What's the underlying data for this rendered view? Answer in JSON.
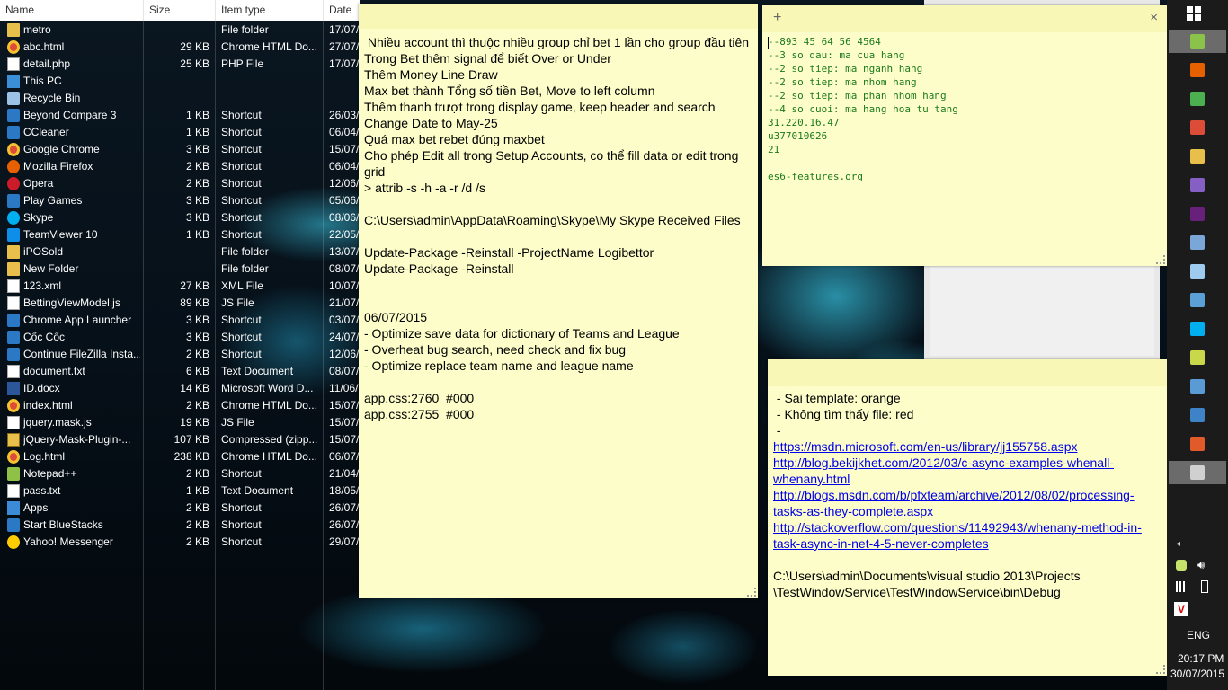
{
  "explorer": {
    "columns": {
      "name": "Name",
      "size": "Size",
      "type": "Item type",
      "date": "Date m"
    },
    "rows": [
      {
        "name": "metro",
        "size": "",
        "type": "File folder",
        "date": "17/07/",
        "icon": "folder-icon"
      },
      {
        "name": "abc.html",
        "size": "29 KB",
        "type": "Chrome HTML Do...",
        "date": "27/07/",
        "icon": "chrome-icon"
      },
      {
        "name": "detail.php",
        "size": "25 KB",
        "type": "PHP File",
        "date": "17/07/",
        "icon": "php-file-icon"
      },
      {
        "name": "This PC",
        "size": "",
        "type": "",
        "date": "",
        "icon": "computer-icon"
      },
      {
        "name": "Recycle Bin",
        "size": "",
        "type": "",
        "date": "",
        "icon": "recycle-bin-icon"
      },
      {
        "name": "Beyond Compare 3",
        "size": "1 KB",
        "type": "Shortcut",
        "date": "26/03/",
        "icon": "shortcut-icon"
      },
      {
        "name": "CCleaner",
        "size": "1 KB",
        "type": "Shortcut",
        "date": "06/04/",
        "icon": "shortcut-icon"
      },
      {
        "name": "Google Chrome",
        "size": "3 KB",
        "type": "Shortcut",
        "date": "15/07/",
        "icon": "chrome-icon"
      },
      {
        "name": "Mozilla Firefox",
        "size": "2 KB",
        "type": "Shortcut",
        "date": "06/04/",
        "icon": "firefox-icon"
      },
      {
        "name": "Opera",
        "size": "2 KB",
        "type": "Shortcut",
        "date": "12/06/",
        "icon": "opera-icon"
      },
      {
        "name": "Play Games",
        "size": "3 KB",
        "type": "Shortcut",
        "date": "05/06/",
        "icon": "shortcut-icon"
      },
      {
        "name": "Skype",
        "size": "3 KB",
        "type": "Shortcut",
        "date": "08/06/",
        "icon": "skype-icon"
      },
      {
        "name": "TeamViewer 10",
        "size": "1 KB",
        "type": "Shortcut",
        "date": "22/05/",
        "icon": "teamviewer-icon"
      },
      {
        "name": "iPOSold",
        "size": "",
        "type": "File folder",
        "date": "13/07/",
        "icon": "folder-icon"
      },
      {
        "name": "New Folder",
        "size": "",
        "type": "File folder",
        "date": "08/07/",
        "icon": "folder-icon"
      },
      {
        "name": "123.xml",
        "size": "27 KB",
        "type": "XML File",
        "date": "10/07/",
        "icon": "document-icon"
      },
      {
        "name": "BettingViewModel.js",
        "size": "89 KB",
        "type": "JS File",
        "date": "21/07/",
        "icon": "document-icon"
      },
      {
        "name": "Chrome App Launcher",
        "size": "3 KB",
        "type": "Shortcut",
        "date": "03/07/",
        "icon": "shortcut-icon"
      },
      {
        "name": "Cốc Cốc",
        "size": "3 KB",
        "type": "Shortcut",
        "date": "24/07/",
        "icon": "shortcut-icon"
      },
      {
        "name": "Continue FileZilla Insta...",
        "size": "2 KB",
        "type": "Shortcut",
        "date": "12/06/",
        "icon": "shortcut-icon"
      },
      {
        "name": "document.txt",
        "size": "6 KB",
        "type": "Text Document",
        "date": "08/07/",
        "icon": "document-icon"
      },
      {
        "name": "ID.docx",
        "size": "14 KB",
        "type": "Microsoft Word D...",
        "date": "11/06/",
        "icon": "word-icon"
      },
      {
        "name": "index.html",
        "size": "2 KB",
        "type": "Chrome HTML Do...",
        "date": "15/07/",
        "icon": "chrome-icon"
      },
      {
        "name": "jquery.mask.js",
        "size": "19 KB",
        "type": "JS File",
        "date": "15/07/",
        "icon": "document-icon"
      },
      {
        "name": "jQuery-Mask-Plugin-...",
        "size": "107 KB",
        "type": "Compressed (zipp...",
        "date": "15/07/",
        "icon": "zip-icon"
      },
      {
        "name": "Log.html",
        "size": "238 KB",
        "type": "Chrome HTML Do...",
        "date": "06/07/",
        "icon": "chrome-icon"
      },
      {
        "name": "Notepad++",
        "size": "2 KB",
        "type": "Shortcut",
        "date": "21/04/",
        "icon": "notepad-icon"
      },
      {
        "name": "pass.txt",
        "size": "1 KB",
        "type": "Text Document",
        "date": "18/05/",
        "icon": "document-icon"
      },
      {
        "name": "Apps",
        "size": "2 KB",
        "type": "Shortcut",
        "date": "26/07/",
        "icon": "apps-icon"
      },
      {
        "name": "Start BlueStacks",
        "size": "2 KB",
        "type": "Shortcut",
        "date": "26/07/",
        "icon": "shortcut-icon"
      },
      {
        "name": "Yahoo! Messenger",
        "size": "2 KB",
        "type": "Shortcut",
        "date": "29/07/",
        "icon": "yahoo-icon"
      }
    ]
  },
  "note1": {
    "text": " Nhiều account thì thuộc nhiều group chỉ bet 1 lần cho group đầu tiên\nTrong Bet thêm signal để biết Over or Under\nThêm Money Line Draw\nMax bet thành Tổng số tiền Bet, Move to left column\nThêm thanh trượt trong display game, keep header and search\nChange Date to May-25\nQuá max bet rebet đúng maxbet\nCho phép Edit all trong Setup Accounts, co thể fill data or edit trong grid\n> attrib -s -h -a -r /d /s\n\nC:\\Users\\admin\\AppData\\Roaming\\Skype\\My Skype Received Files\n\nUpdate-Package -Reinstall -ProjectName Logibettor\nUpdate-Package -Reinstall\n\n\n06/07/2015\n- Optimize save data for dictionary of Teams and League\n- Overheat bug search, need check and fix bug\n- Optimize replace team name and league name\n\napp.css:2760  #000\napp.css:2755  #000"
  },
  "note2": {
    "add_label": "+",
    "close_label": "×",
    "text": "--893 45 64 56 4564\n--3 so dau: ma cua hang\n--2 so tiep: ma nganh hang\n--2 so tiep: ma nhom hang\n--2 so tiep: ma phan nhom hang\n--4 so cuoi: ma hang hoa tu tang\n31.220.16.47\nu377010626\n21\n\nes6-features.org"
  },
  "note3": {
    "line1": " - Sai template: orange",
    "line2": " - Không tìm thấy file: red",
    "line3": " -",
    "links": [
      "https://msdn.microsoft.com/en-us/library/jj155758.aspx",
      "http://blog.bekijkhet.com/2012/03/c-async-examples-whenall-whenany.html",
      "http://blogs.msdn.com/b/pfxteam/archive/2012/08/02/processing-tasks-as-they-complete.aspx",
      "http://stackoverflow.com/questions/11492943/whenany-method-in-task-async-in-net-4-5-never-completes"
    ],
    "path": "C:\\Users\\admin\\Documents\\visual studio 2013\\Projects\n\\TestWindowService\\TestWindowService\\bin\\Debug"
  },
  "taskbar": {
    "apps": [
      {
        "name": "file-manager-icon",
        "color": "#8bc34a"
      },
      {
        "name": "firefox-icon",
        "color": "#e66000"
      },
      {
        "name": "refresh-app-icon",
        "color": "#4caf50"
      },
      {
        "name": "chrome-icon",
        "color": "#dd4b39"
      },
      {
        "name": "folder-icon",
        "color": "#e8bf4a"
      },
      {
        "name": "visual-studio-icon",
        "color": "#865fc5"
      },
      {
        "name": "visual-studio-alt-icon",
        "color": "#68217a"
      },
      {
        "name": "tools-icon",
        "color": "#7aa7d8"
      },
      {
        "name": "network-icon",
        "color": "#9ecbee"
      },
      {
        "name": "chat-icon",
        "color": "#5c9fd6"
      },
      {
        "name": "skype-icon",
        "color": "#00aff0"
      },
      {
        "name": "notepad-icon",
        "color": "#c8d84a"
      },
      {
        "name": "excel-icon",
        "color": "#5b9bd5"
      },
      {
        "name": "remote-desktop-icon",
        "color": "#3e83c7"
      },
      {
        "name": "paint-icon",
        "color": "#e05a2a"
      },
      {
        "name": "app-icon",
        "color": "#d0d0d0"
      }
    ],
    "language": "ENG",
    "time": "20:17 PM",
    "date": "30/07/2015"
  }
}
